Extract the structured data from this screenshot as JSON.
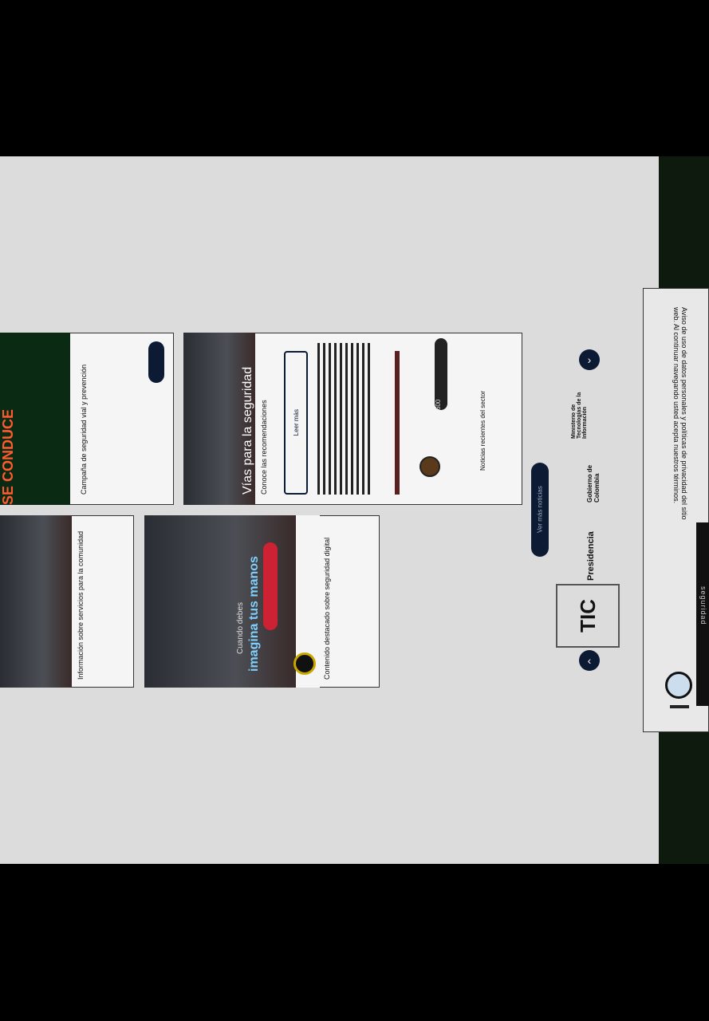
{
  "header": {
    "text": "Aviso de uso de datos personales y políticas de privacidad del sitio web. Al continuar navegando usted acepta nuestros términos.",
    "dark_label": "seguridad"
  },
  "logos": {
    "tic": "TIC",
    "presidencia": "Presidencia",
    "gobierno": "Gobierno de Colombia",
    "ministerio": "Ministerio de Tecnologías de la Información"
  },
  "pill": {
    "label": "Ver más noticias"
  },
  "card_a": {
    "title": "Vías para la seguridad",
    "subtitle": "Conoce las recomendaciones",
    "button": "Leer más",
    "views": "600",
    "footer": "Noticias recientes del sector"
  },
  "card_b": {
    "title": "imagina tus manos",
    "subtitle": "Cuando debes",
    "text": "Contenido destacado sobre seguridad digital"
  },
  "card_c": {
    "poster": "SE CONDUCE",
    "text": "Campaña de seguridad vial y prevención"
  },
  "card_d": {
    "text": "Información sobre servicios para la comunidad"
  }
}
